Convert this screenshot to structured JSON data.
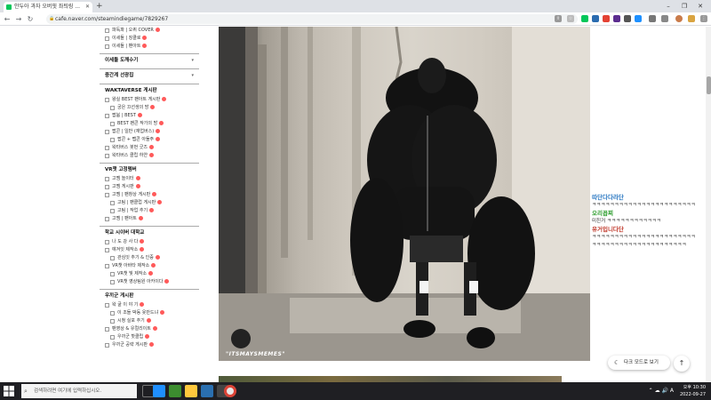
{
  "browser": {
    "tab_title": "안두아 과자 오버핏 좌틔링 ...",
    "url": "cafe.naver.com/steamindiegame/7829267",
    "new_tab_label": "+"
  },
  "sidebar": {
    "items_top": [
      {
        "label": "파독파 | 오퀴 COVER",
        "sub": false,
        "emoji": true
      },
      {
        "label": "이세돌 | 징클로",
        "sub": false,
        "emoji": true
      },
      {
        "label": "이세돌 | 팬아트",
        "sub": false,
        "emoji": true
      }
    ],
    "sections": [
      {
        "title": "이세돌 도깨수기",
        "chevron": "▾",
        "items": []
      },
      {
        "title": "중간계 선광집",
        "chevron": "▾",
        "items": []
      },
      {
        "title": "WAKTAVERSE 게시판",
        "chevron": "",
        "items": [
          {
            "label": "왕실 BEST 팬아트 게시판",
            "sub": false
          },
          {
            "label": "궁은 끄선생의 방",
            "sub": true
          },
          {
            "label": "팝붐 | BEST",
            "sub": false
          },
          {
            "label": "BEST 팬콘 작가의 방",
            "sub": true
          },
          {
            "label": "팝콘 | 일반 (재업버스)",
            "sub": false
          },
          {
            "label": "팝콘 + 팹콘 아둘주",
            "sub": true
          },
          {
            "label": "왁타버스 봇번 굿즈",
            "sub": false
          },
          {
            "label": "왁타버스 클립 하얀",
            "sub": false
          }
        ]
      },
      {
        "title": "VR챗 고정멤버",
        "chevron": "",
        "items": [
          {
            "label": "고멤 놀이터",
            "sub": false
          },
          {
            "label": "고멤 게시판",
            "sub": false
          },
          {
            "label": "고멤 | 팬창상 게시판",
            "sub": false
          },
          {
            "label": "고팀 | 팬클럽 게시판",
            "sub": true
          },
          {
            "label": "고팀 | 작업 추기",
            "sub": true
          },
          {
            "label": "고멤 | 팬아트",
            "sub": false
          }
        ]
      },
      {
        "title": "학교 시이버 대학교",
        "chevron": "",
        "items": [
          {
            "label": "나 도 강 사 다",
            "sub": false
          },
          {
            "label": "얘겨잇 제작소",
            "sub": false
          },
          {
            "label": "관심잇 추기 & 인증",
            "sub": true
          },
          {
            "label": "VR챗 아바타 제작소",
            "sub": false
          },
          {
            "label": "VR챗 빛 제작소",
            "sub": true
          },
          {
            "label": "VR챗 영상팀원 아카이다",
            "sub": true
          }
        ]
      },
      {
        "title": "우끼군 게시판",
        "chevron": "",
        "items": [
          {
            "label": "왁 굴 이 야 기",
            "sub": false
          },
          {
            "label": "이 조들 박동 옷만드냐",
            "sub": true
          },
          {
            "label": "시청 실포 추기",
            "sub": true
          },
          {
            "label": "팬영상 & 유컬리이트",
            "sub": false
          },
          {
            "label": "우끼군 핫클립",
            "sub": true
          },
          {
            "label": "우끼군 공략 게시판",
            "sub": false
          }
        ]
      }
    ]
  },
  "post": {
    "watermark": "\"ITSMAYSMEMES\""
  },
  "chat": {
    "messages": [
      {
        "name": "따단다다라단",
        "name_color": "#2b78c2",
        "text": "ㅋㅋㅋㅋㅋㅋㅋㅋㅋㅋㅋㅋㅋㅋㅋㅋㅋㅋㅋㅋㅋㅋㅋ"
      },
      {
        "name": "오리꼽찌",
        "name_color": "#2f9e2f",
        "text": "미친거 ㅋㅋㅋㅋㅋㅋㅋㅋㅋㅋㅋㅋ"
      },
      {
        "name": "유거입니다단",
        "name_color": "#c0392b",
        "text": "ㅋㅋㅋㅋㅋㅋㅋㅋㅋㅋㅋㅋㅋㅋㅋㅋㅋㅋㅋㅋㅋㅋㅋ"
      }
    ],
    "extra_line": "ㅋㅋㅋㅋㅋㅋㅋㅋㅋㅋㅋㅋㅋㅋㅋㅋㅋㅋㅋㅋㅋ"
  },
  "buttons": {
    "dark_mode": "다크 모드로 보기",
    "top": "↑"
  },
  "taskbar": {
    "search_placeholder": "검색하려면 여기에 입력하십시오.",
    "time": "오후 10:30",
    "date": "2022-09-27"
  },
  "colors": {
    "naver_green": "#03c75a",
    "taskbar_bg": "#1f1f23",
    "badge_red": "#ff5a5a"
  }
}
